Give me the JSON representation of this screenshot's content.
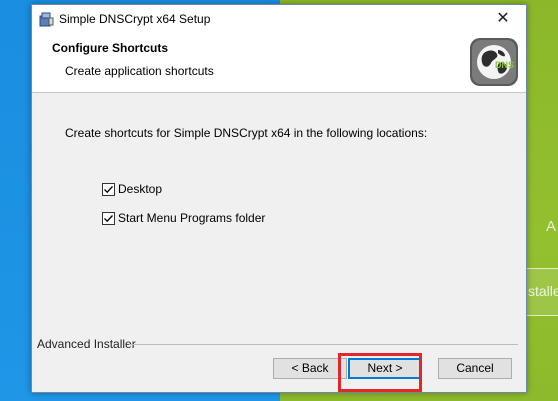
{
  "window": {
    "title": "Simple DNSCrypt x64 Setup",
    "close_glyph": "✕"
  },
  "header": {
    "title": "Configure Shortcuts",
    "subtitle": "Create application shortcuts",
    "logo_text": "DNS",
    "logo_icon": "globe-icon"
  },
  "body": {
    "instruction": "Create shortcuts for Simple DNSCrypt x64 in the following locations:",
    "checkboxes": [
      {
        "label": "Desktop",
        "checked": true
      },
      {
        "label": "Start Menu Programs folder",
        "checked": true
      }
    ]
  },
  "footer": {
    "brand": "Advanced Installer",
    "back_label": "< Back",
    "next_label": "Next >",
    "cancel_label": "Cancel"
  },
  "background": {
    "right_letter": "A",
    "right_box_text": "stalle"
  },
  "colors": {
    "highlight": "#e3262a",
    "desktop_blue": "#1a8ee0",
    "desktop_green": "#8bb82a",
    "focus_blue": "#0078d7"
  }
}
